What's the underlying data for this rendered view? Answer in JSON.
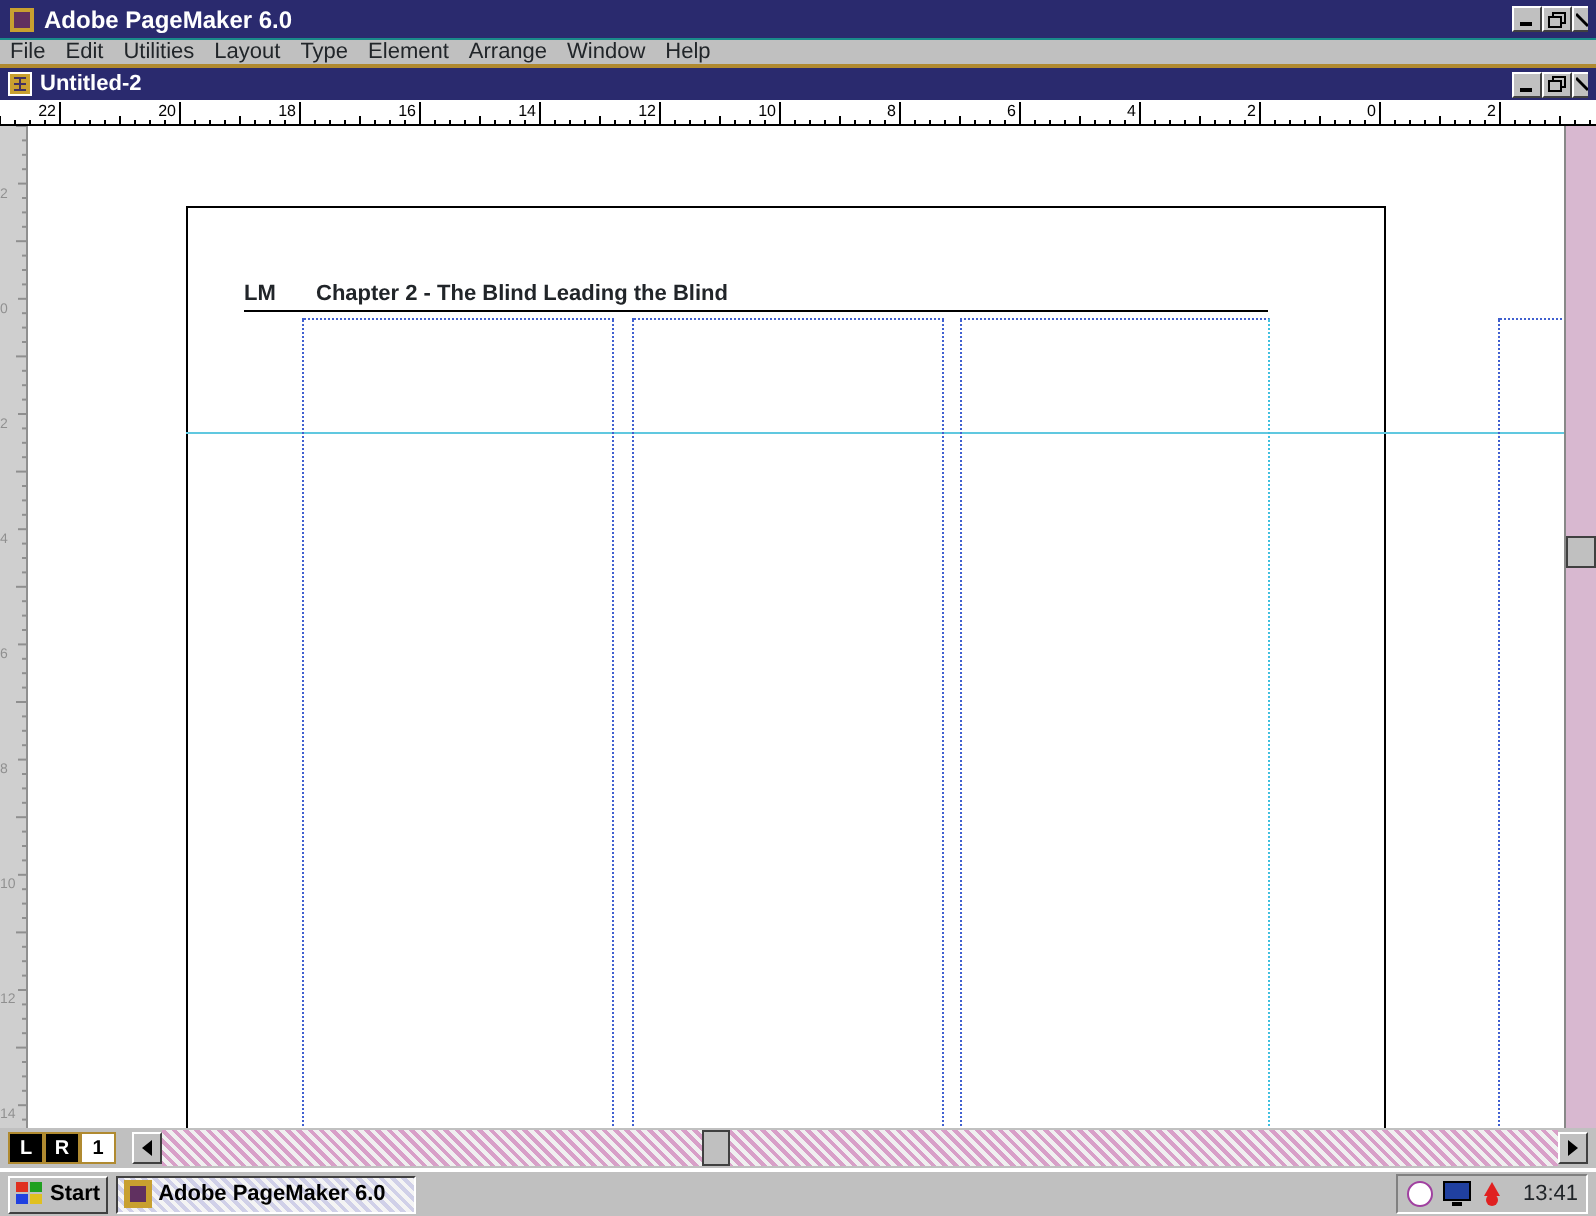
{
  "window": {
    "title": "Adobe PageMaker 6.0"
  },
  "menu": [
    "File",
    "Edit",
    "Utilities",
    "Layout",
    "Type",
    "Element",
    "Arrange",
    "Window",
    "Help"
  ],
  "document": {
    "title": "Untitled-2"
  },
  "hruler": [
    "22",
    "20",
    "18",
    "16",
    "14",
    "12",
    "10",
    "8",
    "6",
    "4",
    "2",
    "0",
    "2"
  ],
  "vruler": [
    "2",
    "0",
    "2",
    "4",
    "6",
    "8",
    "10",
    "12",
    "14"
  ],
  "page": {
    "header_tag": "LM",
    "header_title": "Chapter 2 - The Blind Leading the Blind"
  },
  "page_icons": [
    {
      "label": "L",
      "selected": true
    },
    {
      "label": "R",
      "selected": true
    },
    {
      "label": "1",
      "selected": false
    }
  ],
  "taskbar": {
    "start": "Start",
    "tasks": [
      {
        "label": "Adobe PageMaker 6.0",
        "selected": true
      }
    ],
    "clock": "13:41"
  }
}
